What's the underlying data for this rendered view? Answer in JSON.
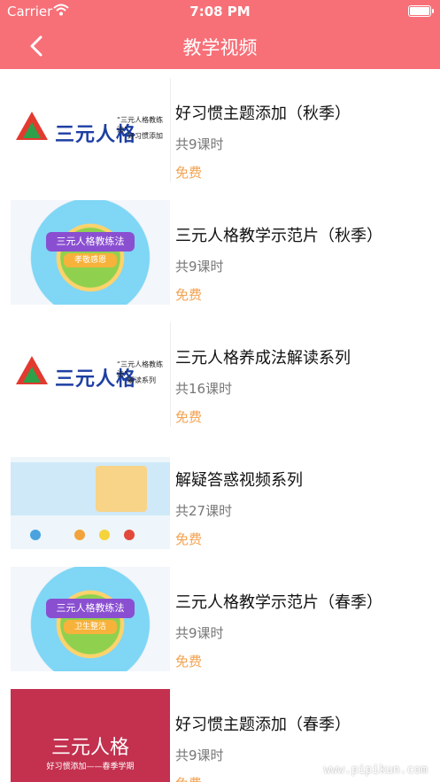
{
  "status": {
    "carrier": "Carrier",
    "time": "7:08 PM"
  },
  "nav": {
    "title": "教学视频"
  },
  "items": [
    {
      "title": "好习惯主题添加（秋季）",
      "lessons": "共9课时",
      "price": "免费"
    },
    {
      "title": "三元人格教学示范片（秋季）",
      "lessons": "共9课时",
      "price": "免费"
    },
    {
      "title": "三元人格养成法解读系列",
      "lessons": "共16课时",
      "price": "免费"
    },
    {
      "title": "解疑答惑视频系列",
      "lessons": "共27课时",
      "price": "免费"
    },
    {
      "title": "三元人格教学示范片（春季）",
      "lessons": "共9课时",
      "price": "免费"
    },
    {
      "title": "好习惯主题添加（春季）",
      "lessons": "共9课时",
      "price": "免费"
    }
  ],
  "thumbs": {
    "brand": "三元人格",
    "t1_sub1": "“三元人格教练法”",
    "t1_sub2": "好习惯添加",
    "t2_banner": "三元人格教练法",
    "t2_sub": "孝敬感恩",
    "t3_sub1": "“三元人格教练法”",
    "t3_sub2": "解读系列",
    "t5_banner": "三元人格教练法",
    "t5_sub": "卫生整洁",
    "t6_big": "三元人格",
    "t6_small": "好习惯添加——春季学期"
  },
  "watermark": "www.pipikun.com"
}
